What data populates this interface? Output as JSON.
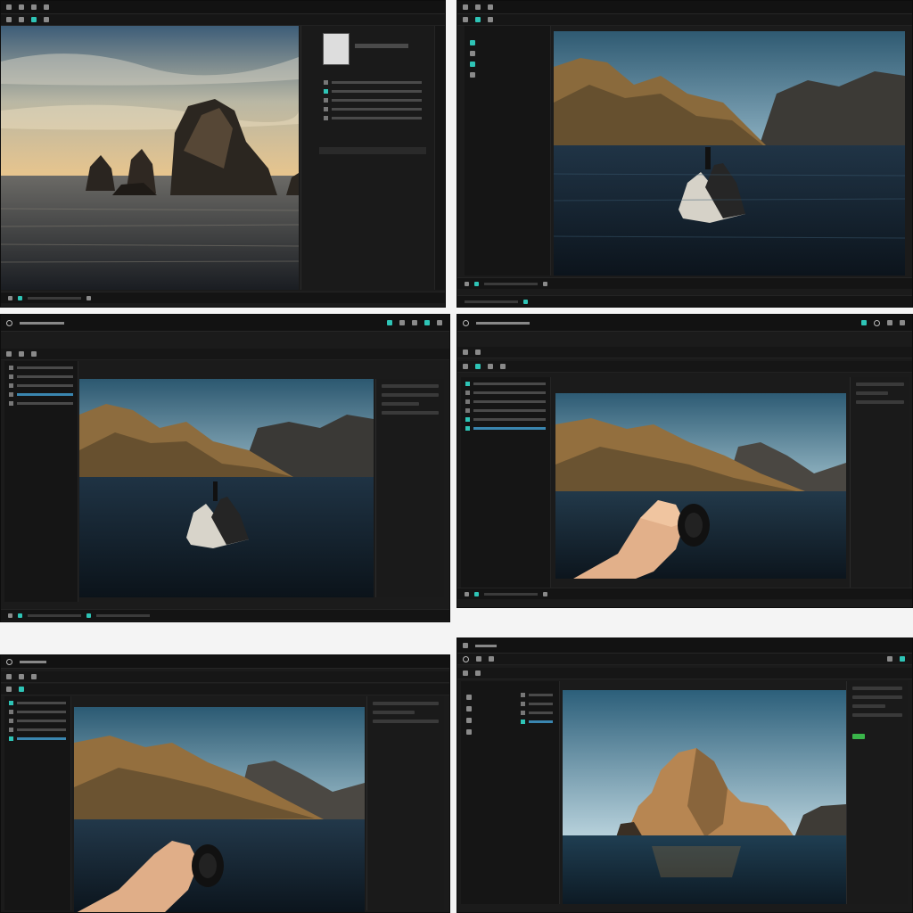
{
  "panels": [
    {
      "id": "p1",
      "scene": "sunset-sea-stacks"
    },
    {
      "id": "p2",
      "scene": "mountains-boat"
    },
    {
      "id": "p3",
      "scene": "mountains-boat"
    },
    {
      "id": "p4",
      "scene": "mountains-hand-lens"
    },
    {
      "id": "p5",
      "scene": "mountains-hand-lens"
    },
    {
      "id": "p6",
      "scene": "rock-island"
    }
  ],
  "colors": {
    "ui_bg": "#1b1b1b",
    "accent": "#2ec4b6",
    "selection": "#3a86b0",
    "green_button": "#3ab54a"
  },
  "icons": [
    "gear-icon",
    "brush-icon",
    "layers-icon",
    "eye-icon",
    "move-tool-icon"
  ]
}
